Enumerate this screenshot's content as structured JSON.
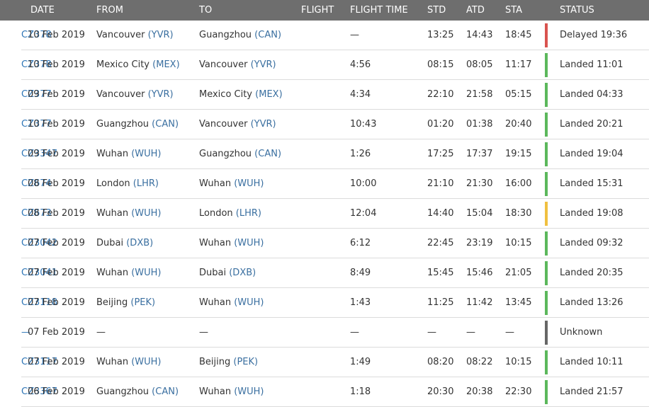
{
  "headers": {
    "date": "DATE",
    "from": "FROM",
    "to": "TO",
    "flight": "FLIGHT",
    "flight_time": "FLIGHT TIME",
    "std": "STD",
    "atd": "ATD",
    "sta": "STA",
    "status": "STATUS"
  },
  "status_colors": {
    "red": "#d9534f",
    "green": "#5cb85c",
    "yellow": "#f0c040",
    "gray": "#666666"
  },
  "rows": [
    {
      "date": "10 Feb 2019",
      "from_city": "Vancouver",
      "from_code": "(YVR)",
      "to_city": "Guangzhou",
      "to_code": "(CAN)",
      "flight": "CZ378",
      "flight_time": "—",
      "std": "13:25",
      "atd": "14:43",
      "sta": "18:45",
      "status": "Delayed 19:36",
      "status_color": "red"
    },
    {
      "date": "10 Feb 2019",
      "from_city": "Mexico City",
      "from_code": "(MEX)",
      "to_city": "Vancouver",
      "to_code": "(YVR)",
      "flight": "CZ378",
      "flight_time": "4:56",
      "std": "08:15",
      "atd": "08:05",
      "sta": "11:17",
      "status": "Landed 11:01",
      "status_color": "green"
    },
    {
      "date": "09 Feb 2019",
      "from_city": "Vancouver",
      "from_code": "(YVR)",
      "to_city": "Mexico City",
      "to_code": "(MEX)",
      "flight": "CZ377",
      "flight_time": "4:34",
      "std": "22:10",
      "atd": "21:58",
      "sta": "05:15",
      "status": "Landed 04:33",
      "status_color": "green"
    },
    {
      "date": "10 Feb 2019",
      "from_city": "Guangzhou",
      "from_code": "(CAN)",
      "to_city": "Vancouver",
      "to_code": "(YVR)",
      "flight": "CZ377",
      "flight_time": "10:43",
      "std": "01:20",
      "atd": "01:38",
      "sta": "20:40",
      "status": "Landed 20:21",
      "status_color": "green"
    },
    {
      "date": "09 Feb 2019",
      "from_city": "Wuhan",
      "from_code": "(WUH)",
      "to_city": "Guangzhou",
      "to_code": "(CAN)",
      "flight": "CZ3347",
      "flight_time": "1:26",
      "std": "17:25",
      "atd": "17:37",
      "sta": "19:15",
      "status": "Landed 19:04",
      "status_color": "green"
    },
    {
      "date": "08 Feb 2019",
      "from_city": "London",
      "from_code": "(LHR)",
      "to_city": "Wuhan",
      "to_code": "(WUH)",
      "flight": "CZ674",
      "flight_time": "10:00",
      "std": "21:10",
      "atd": "21:30",
      "sta": "16:00",
      "status": "Landed 15:31",
      "status_color": "green"
    },
    {
      "date": "08 Feb 2019",
      "from_city": "Wuhan",
      "from_code": "(WUH)",
      "to_city": "London",
      "to_code": "(LHR)",
      "flight": "CZ673",
      "flight_time": "12:04",
      "std": "14:40",
      "atd": "15:04",
      "sta": "18:30",
      "status": "Landed 19:08",
      "status_color": "yellow"
    },
    {
      "date": "07 Feb 2019",
      "from_city": "Dubai",
      "from_code": "(DXB)",
      "to_city": "Wuhan",
      "to_code": "(WUH)",
      "flight": "CZ3042",
      "flight_time": "6:12",
      "std": "22:45",
      "atd": "23:19",
      "sta": "10:15",
      "status": "Landed 09:32",
      "status_color": "green"
    },
    {
      "date": "07 Feb 2019",
      "from_city": "Wuhan",
      "from_code": "(WUH)",
      "to_city": "Dubai",
      "to_code": "(DXB)",
      "flight": "CZ3041",
      "flight_time": "8:49",
      "std": "15:45",
      "atd": "15:46",
      "sta": "21:05",
      "status": "Landed 20:35",
      "status_color": "green"
    },
    {
      "date": "07 Feb 2019",
      "from_city": "Beijing",
      "from_code": "(PEK)",
      "to_city": "Wuhan",
      "to_code": "(WUH)",
      "flight": "CZ3118",
      "flight_time": "1:43",
      "std": "11:25",
      "atd": "11:42",
      "sta": "13:45",
      "status": "Landed 13:26",
      "status_color": "green"
    },
    {
      "date": "07 Feb 2019",
      "from_city": "—",
      "from_code": "",
      "to_city": "—",
      "to_code": "",
      "flight": "—",
      "flight_time": "—",
      "std": "—",
      "atd": "—",
      "sta": "—",
      "status": "Unknown",
      "status_color": "gray"
    },
    {
      "date": "07 Feb 2019",
      "from_city": "Wuhan",
      "from_code": "(WUH)",
      "to_city": "Beijing",
      "to_code": "(PEK)",
      "flight": "CZ3117",
      "flight_time": "1:49",
      "std": "08:20",
      "atd": "08:22",
      "sta": "10:15",
      "status": "Landed 10:11",
      "status_color": "green"
    },
    {
      "date": "06 Feb 2019",
      "from_city": "Guangzhou",
      "from_code": "(CAN)",
      "to_city": "Wuhan",
      "to_code": "(WUH)",
      "flight": "CZ3367",
      "flight_time": "1:18",
      "std": "20:30",
      "atd": "20:38",
      "sta": "22:30",
      "status": "Landed 21:57",
      "status_color": "green"
    }
  ]
}
